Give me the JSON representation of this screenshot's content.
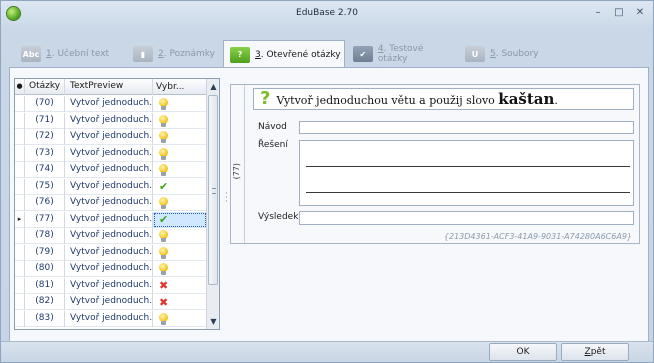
{
  "window": {
    "title": "EduBase 2.70",
    "min_glyph": "–",
    "max_glyph": "□",
    "close_glyph": "✕"
  },
  "tabs": [
    {
      "icon_text": "Abc",
      "key": "1",
      "label": ". Učební text",
      "active": false
    },
    {
      "icon_text": "▮",
      "key": "2",
      "label": ". Poznámky",
      "active": false
    },
    {
      "icon_text": "?",
      "key": "3",
      "label": ". Otevřené otázky",
      "active": true
    },
    {
      "icon_text": "✔",
      "key": "4",
      "label": ". Testové otázky",
      "active": false
    },
    {
      "icon_text": "U",
      "key": "5",
      "label": ". Soubory",
      "active": false
    }
  ],
  "grid": {
    "headers": {
      "selector": "●",
      "number": "Otázky",
      "sort": "/",
      "text": "TextPreview",
      "icon": "Vybr..."
    },
    "rows": [
      {
        "number": "(70)",
        "text": "Vytvoř jednoduch...",
        "icon": "bulb"
      },
      {
        "number": "(71)",
        "text": "Vytvoř jednoduch...",
        "icon": "bulb"
      },
      {
        "number": "(72)",
        "text": "Vytvoř jednoduch...",
        "icon": "bulb"
      },
      {
        "number": "(73)",
        "text": "Vytvoř jednoduch...",
        "icon": "bulb"
      },
      {
        "number": "(74)",
        "text": "Vytvoř jednoduch...",
        "icon": "bulb"
      },
      {
        "number": "(75)",
        "text": "Vytvoř jednoduch...",
        "icon": "check"
      },
      {
        "number": "(76)",
        "text": "Vytvoř jednoduch...",
        "icon": "bulb"
      },
      {
        "number": "(77)",
        "text": "Vytvoř jednoduch...",
        "icon": "check",
        "current": true,
        "marker": "▸"
      },
      {
        "number": "(78)",
        "text": "Vytvoř jednoduch...",
        "icon": "bulb"
      },
      {
        "number": "(79)",
        "text": "Vytvoř jednoduch...",
        "icon": "bulb"
      },
      {
        "number": "(80)",
        "text": "Vytvoř jednoduch...",
        "icon": "bulb"
      },
      {
        "number": "(81)",
        "text": "Vytvoř jednoduch...",
        "icon": "cross"
      },
      {
        "number": "(82)",
        "text": "Vytvoř jednoduch...",
        "icon": "cross"
      },
      {
        "number": "(83)",
        "text": "Vytvoř jednoduch...",
        "icon": "bulb"
      }
    ]
  },
  "detail": {
    "side_label": "(77)",
    "question_prefix": "Vytvoř jednoduchou větu a použij slovo ",
    "question_keyword": "kaštan",
    "question_suffix": ".",
    "navod_label": "Návod",
    "navod_value": "",
    "reseni_label": "Řešení",
    "vysledek_label": "Výsledek",
    "vysledek_value": "",
    "guid": "{213D4361-ACF3-41A9-9031-A74280A6C6A9}"
  },
  "buttons": {
    "ok": "OK",
    "back_key": "Z",
    "back_rest": "pět"
  },
  "colors": {
    "accent_green": "#4f9f1e",
    "tab_border": "#9fb1c8",
    "check": "#3ea51d",
    "cross": "#e0352b"
  }
}
